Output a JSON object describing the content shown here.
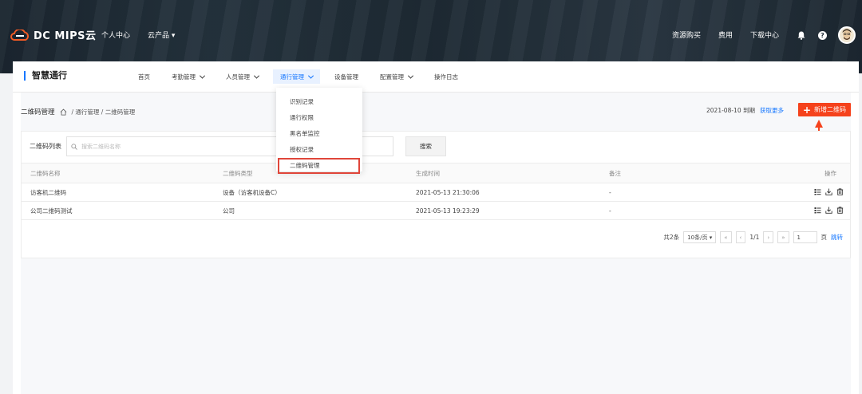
{
  "topbar": {
    "logo_text": "DC MIPS云",
    "nav_left": [
      "个人中心",
      "云产品"
    ],
    "nav_right": [
      "资源购买",
      "费用",
      "下载中心"
    ]
  },
  "app": {
    "title": "智慧通行",
    "nav": [
      {
        "label": "首页",
        "dropdown": false,
        "active": false
      },
      {
        "label": "考勤管理",
        "dropdown": true,
        "active": false
      },
      {
        "label": "人员管理",
        "dropdown": true,
        "active": false
      },
      {
        "label": "通行管理",
        "dropdown": true,
        "active": true
      },
      {
        "label": "设备管理",
        "dropdown": false,
        "active": false
      },
      {
        "label": "配置管理",
        "dropdown": true,
        "active": false
      },
      {
        "label": "操作日志",
        "dropdown": false,
        "active": false
      }
    ],
    "dropdown_items": [
      "识别记录",
      "通行权限",
      "黑名单监控",
      "授权记录",
      "二维码管理"
    ]
  },
  "page": {
    "title": "二维码管理",
    "breadcrumb": "/ 通行管理 / 二维码管理",
    "expiry": "2021-08-10 到期",
    "more_link": "获取更多",
    "add_button": "新增二维码",
    "list_label": "二维码列表",
    "search_placeholder": "搜索二维码名称",
    "search_button": "搜索"
  },
  "table": {
    "headers": [
      "二维码名称",
      "二维码类型",
      "生成时间",
      "备注",
      "操作"
    ],
    "rows": [
      {
        "name": "访客机二维码",
        "type": "设备（访客机设备C）",
        "time": "2021-05-13 21:30:06",
        "note": "-"
      },
      {
        "name": "公司二维码测试",
        "type": "公司",
        "time": "2021-05-13 19:23:29",
        "note": "-"
      }
    ]
  },
  "pager": {
    "total": "共2条",
    "page_size": "10条/页",
    "first": "«",
    "prev": "‹",
    "pages": "1/1",
    "next": "›",
    "last": "»",
    "page_input": "1",
    "page_suffix": "页",
    "jump": "跳转"
  },
  "colors": {
    "accent": "#1677ff",
    "add_button": "#f5421c",
    "highlight_border": "#e0463a"
  }
}
